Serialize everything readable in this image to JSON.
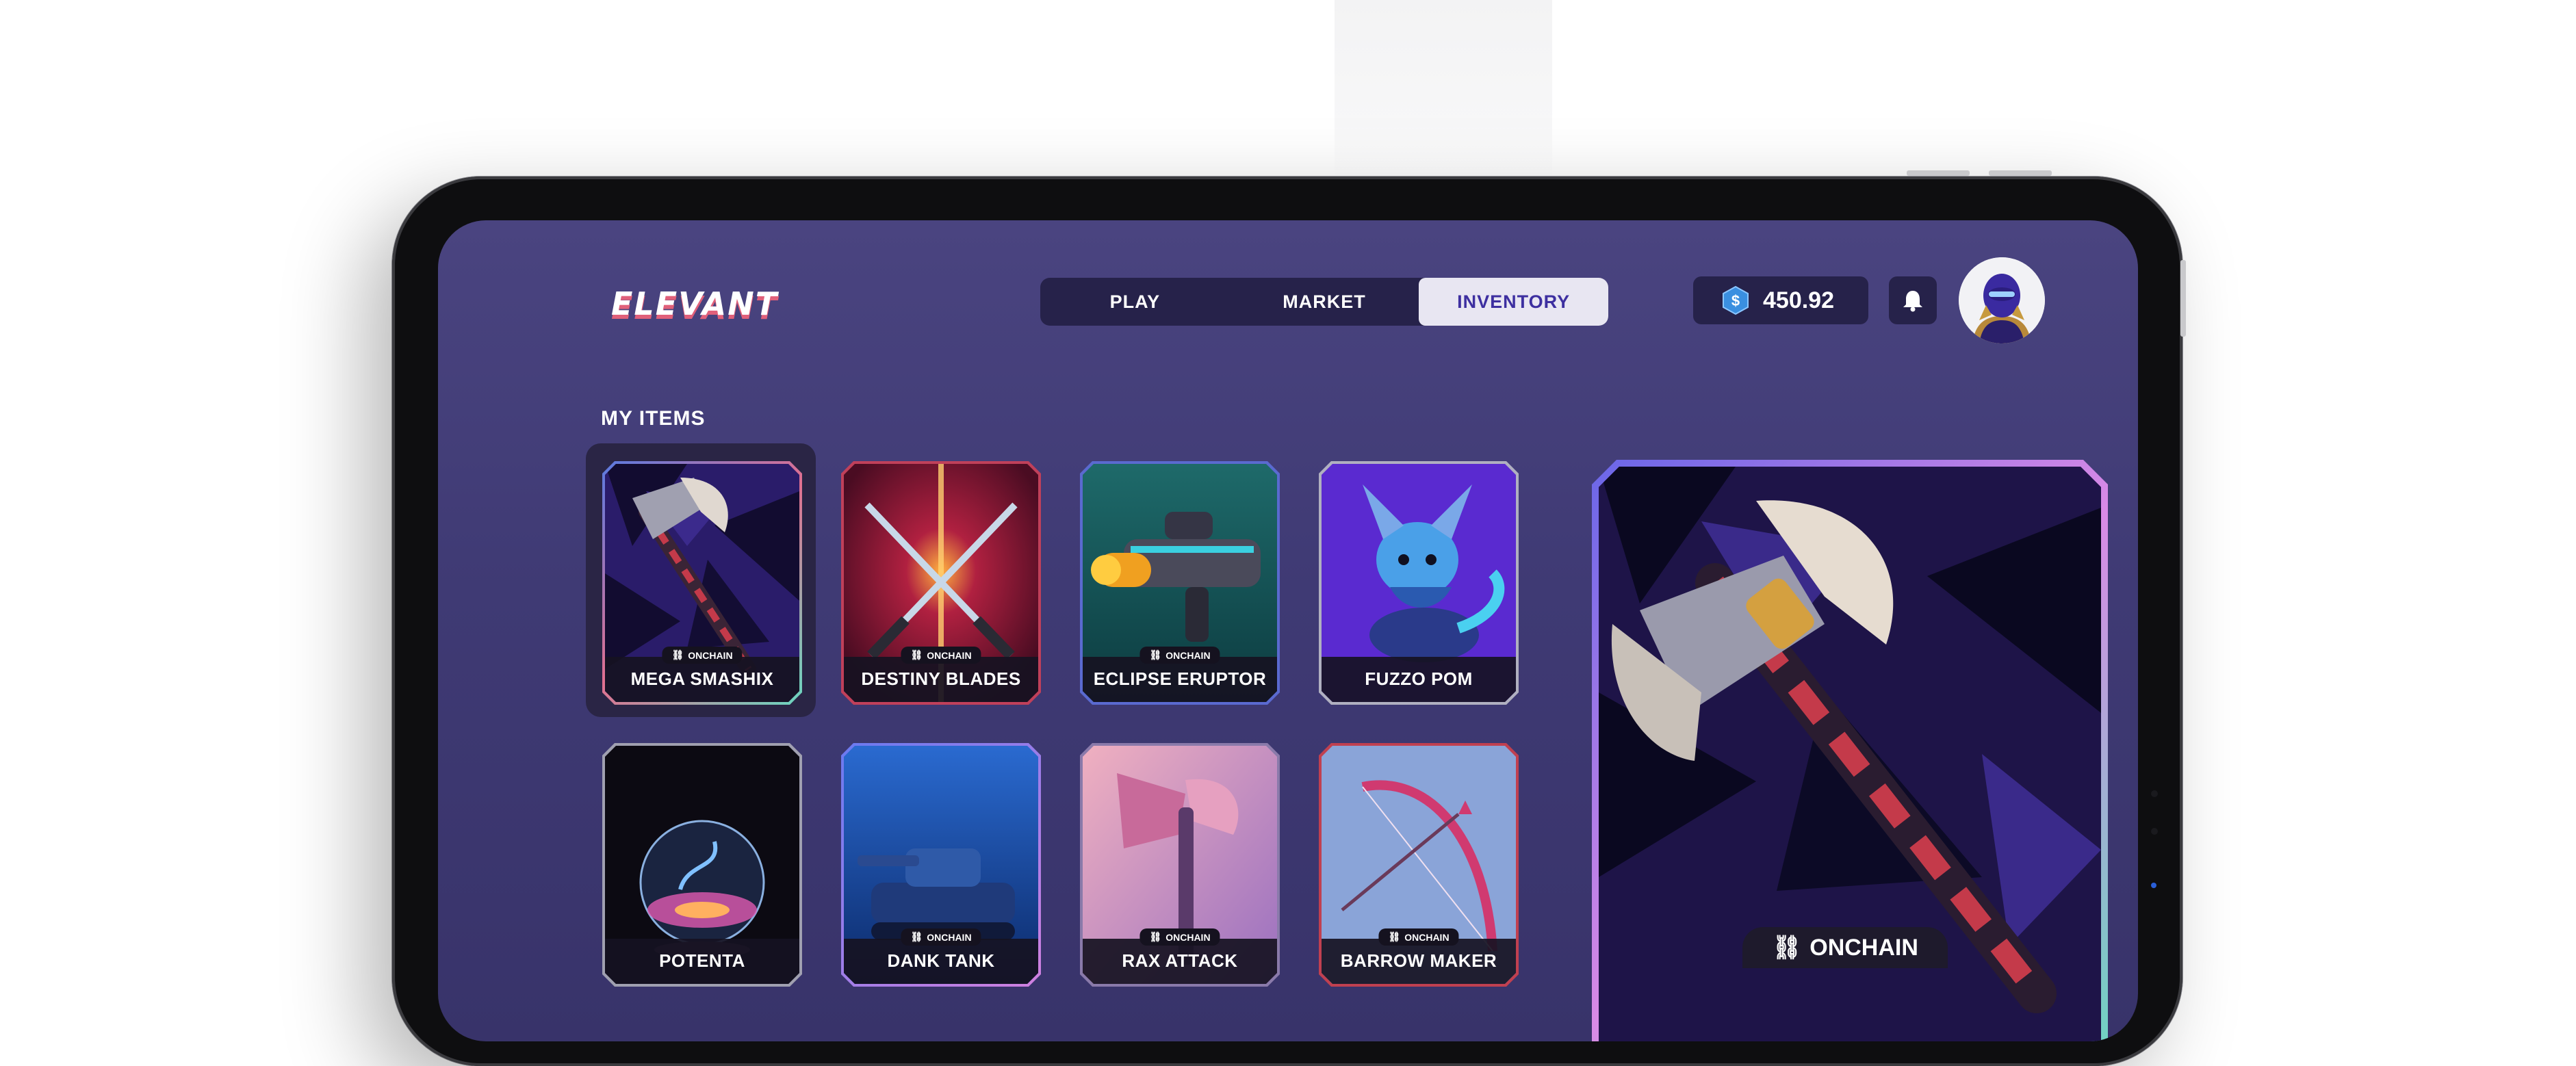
{
  "app": {
    "logo": "ELEVANT"
  },
  "nav": {
    "tabs": [
      "PLAY",
      "MARKET",
      "INVENTORY"
    ],
    "active": "INVENTORY"
  },
  "wallet": {
    "balance": "450.92",
    "currency_icon": "coin-icon"
  },
  "icons": {
    "bell": "bell-icon",
    "link": "link-icon"
  },
  "section": {
    "title": "MY ITEMS"
  },
  "items": [
    {
      "name": "MEGA SMASHIX",
      "tag": "ONCHAIN",
      "selected": true
    },
    {
      "name": "DESTINY BLADES",
      "tag": "ONCHAIN"
    },
    {
      "name": "ECLIPSE ERUPTOR",
      "tag": "ONCHAIN"
    },
    {
      "name": "FUZZO POM",
      "tag": ""
    },
    {
      "name": "POTENTA",
      "tag": ""
    },
    {
      "name": "DANK TANK",
      "tag": "ONCHAIN"
    },
    {
      "name": "RAX ATTACK",
      "tag": "ONCHAIN"
    },
    {
      "name": "BARROW MAKER",
      "tag": "ONCHAIN"
    }
  ],
  "detail": {
    "tag": "ONCHAIN"
  },
  "colors": {
    "screen_bg": "#443f7c",
    "accent_logo": "#e0607a",
    "nav_active": "#e8e6f2",
    "panel": "#26224a"
  }
}
